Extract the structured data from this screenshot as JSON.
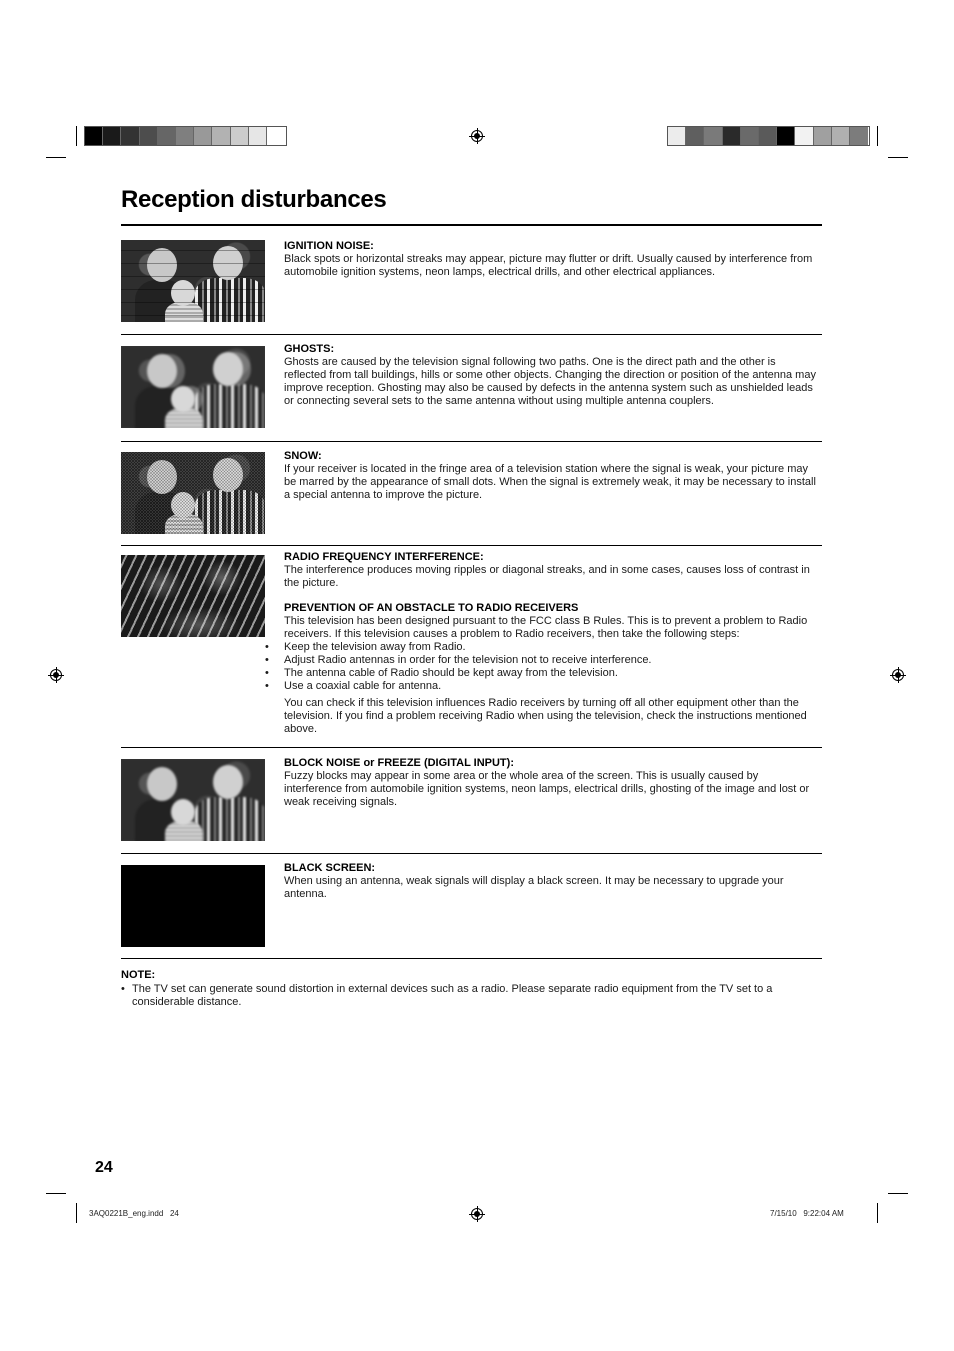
{
  "colorbars": {
    "left": [
      "#000000",
      "#1a1a1a",
      "#333333",
      "#4d4d4d",
      "#666666",
      "#7f7f7f",
      "#999999",
      "#b2b2b2",
      "#cccccc",
      "#e6e6e6",
      "#ffffff"
    ],
    "right": [
      "#ececec",
      "#5f5f5f",
      "#7a7a7a",
      "#2a2a2a",
      "#6a6a6a",
      "#5a5a5a",
      "#000000",
      "#f2f2f2",
      "#a0a0a0",
      "#b0b0b0",
      "#7c7c7c"
    ]
  },
  "page_title": "Reception disturbances",
  "sections": [
    {
      "heading": "IGNITION NOISE:",
      "body": "Black spots or horizontal streaks may appear, picture may flutter or drift. Usually caused by interference from automobile ignition systems, neon lamps, electrical drills, and other electrical appliances.",
      "image": "ignition-noise-photo"
    },
    {
      "heading": "GHOSTS:",
      "body": "Ghosts are caused by the television signal following two paths. One is the direct path and the other is reflected from tall buildings, hills or some other objects. Changing the direction or position of the antenna may improve reception. Ghosting may also be caused by defects in the antenna system such as unshielded leads or connecting several sets to the same antenna without using multiple antenna couplers.",
      "image": "ghosts-photo"
    },
    {
      "heading": "SNOW:",
      "body": "If your receiver is located in the fringe area of a television station where the signal is weak, your picture may be marred by the appearance of small dots. When the signal is extremely weak, it may be necessary to install a special antenna to improve the picture.",
      "image": "snow-photo"
    },
    {
      "heading": "RADIO FREQUENCY INTERFERENCE:",
      "body": "The interference produces moving ripples or diagonal streaks, and in some cases, causes loss of contrast in the picture.",
      "subheading": "PREVENTION OF AN OBSTACLE TO RADIO RECEIVERS",
      "subbody": "This television has been designed pursuant to the FCC class B Rules. This is to prevent a problem to Radio receivers. If this television causes a problem to Radio receivers, then take the following steps:",
      "bullets": [
        "Keep the television away from Radio.",
        "Adjust Radio antennas in order for the television not to receive interference.",
        "The antenna cable of Radio should be kept away from the television.",
        "Use a coaxial cable for antenna."
      ],
      "closing": "You can check if this television influences Radio receivers by turning off all other equipment other than the television. If you find a problem receiving Radio when using the television, check the instructions mentioned above.",
      "image": "radio-interference-photo"
    },
    {
      "heading": "BLOCK NOISE or FREEZE (DIGITAL INPUT):",
      "body": "Fuzzy blocks may appear in some area or the whole area of the screen. This is usually caused by interference from automobile ignition systems, neon lamps, electrical drills, ghosting of the image and lost or weak receiving signals.",
      "image": "block-noise-photo"
    },
    {
      "heading": "BLACK SCREEN:",
      "body": "When using an antenna, weak signals will display a black screen. It may be necessary to upgrade your antenna.",
      "image": "black-screen"
    }
  ],
  "note": {
    "heading": "NOTE:",
    "bullet": "•",
    "body": "The TV set can generate sound distortion in external devices such as a radio. Please separate radio equipment from the TV set to a considerable distance."
  },
  "page_number": "24",
  "slug": {
    "file": "3AQ0221B_eng.indd   24",
    "timestamp": "7/15/10   9:22:04 AM"
  }
}
